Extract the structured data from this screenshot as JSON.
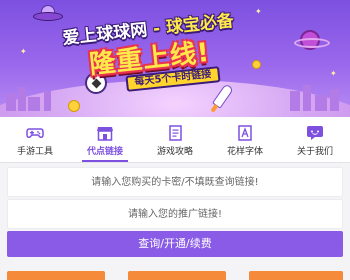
{
  "banner": {
    "title_line1_part1": "爱上球球网",
    "title_line1_part2": "- 球宝必备",
    "title_line2": "隆重上线!",
    "ribbon": "每天5个卡时链接"
  },
  "nav": {
    "items": [
      {
        "label": "手游工具",
        "icon": "gamepad-icon"
      },
      {
        "label": "代点链接",
        "icon": "shop-icon"
      },
      {
        "label": "游戏攻略",
        "icon": "document-icon"
      },
      {
        "label": "花样字体",
        "icon": "font-icon"
      },
      {
        "label": "关于我们",
        "icon": "chat-icon"
      }
    ],
    "active_index": 1
  },
  "form": {
    "card_placeholder": "请输入您购买的卡密/不填既查询链接!",
    "link_placeholder": "请输入您的推广链接!",
    "submit_label": "查询/开通/续费"
  },
  "colors": {
    "accent": "#8a5be6",
    "active_nav": "#7d50e0",
    "orange": "#f58a3a"
  }
}
